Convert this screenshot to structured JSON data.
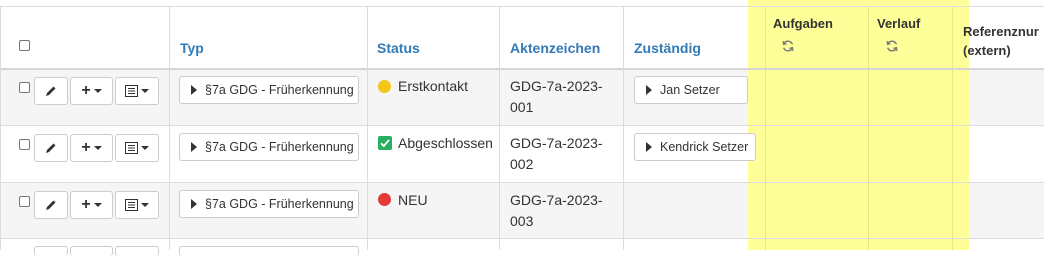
{
  "columns": {
    "typ": "Typ",
    "status": "Status",
    "aktenzeichen": "Aktenzeichen",
    "zustaendig": "Zuständig",
    "aufgaben": "Aufgaben",
    "verlauf": "Verlauf",
    "referenz_line1": "Referenznur",
    "referenz_line2": "(extern)"
  },
  "colors": {
    "link": "#337ab7",
    "highlight": "#ffff99",
    "status_yellow": "#f5c518",
    "status_green": "#27ae60",
    "status_red": "#e53935"
  },
  "rows": [
    {
      "typ": "§7a GDG - Früherkennung",
      "status": "Erstkontakt",
      "status_icon": "yellow-dot-icon",
      "aktenzeichen_line1": "GDG-7a-2023-",
      "aktenzeichen_line2": "001",
      "zustaendig": "Jan Setzer"
    },
    {
      "typ": "§7a GDG - Früherkennung",
      "status": "Abgeschlossen",
      "status_icon": "green-check-icon",
      "aktenzeichen_line1": "GDG-7a-2023-",
      "aktenzeichen_line2": "002",
      "zustaendig": "Kendrick Setzer"
    },
    {
      "typ": "§7a GDG - Früherkennung",
      "status": "NEU",
      "status_icon": "red-dot-icon",
      "aktenzeichen_line1": "GDG-7a-2023-",
      "aktenzeichen_line2": "003",
      "zustaendig": ""
    }
  ]
}
